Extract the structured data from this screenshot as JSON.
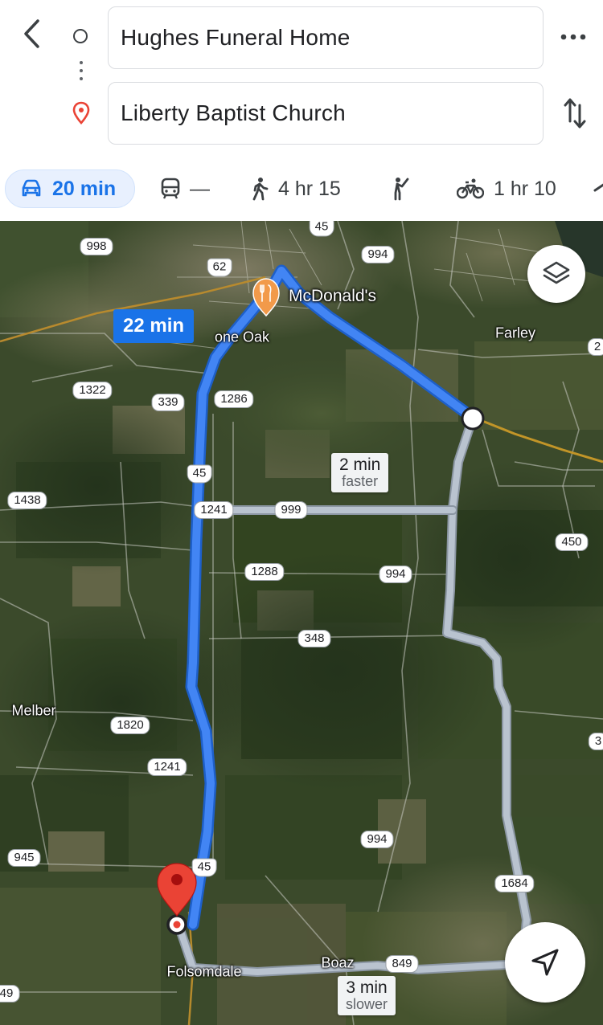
{
  "directions": {
    "origin": "Hughes Funeral Home",
    "destination": "Liberty Baptist Church"
  },
  "modes": [
    {
      "name": "car-icon",
      "label": "20 min",
      "selected": true
    },
    {
      "name": "transit-icon",
      "label": "—"
    },
    {
      "name": "walk-icon",
      "label": "4 hr 15"
    },
    {
      "name": "ride-hail-icon",
      "label": ""
    },
    {
      "name": "bike-icon",
      "label": "1 hr 10"
    }
  ],
  "map": {
    "route_main_time": "22 min",
    "alt_route_1": {
      "time": "2 min",
      "note": "faster"
    },
    "alt_route_2": {
      "time": "3 min",
      "note": "slower"
    },
    "poi": "McDonald's",
    "towns": {
      "lone_oak": "one Oak",
      "farley": "Farley",
      "melber": "Melber",
      "folsomdale": "Folsomdale",
      "boaz": "Boaz"
    },
    "shields": {
      "s45_top": "45",
      "s998": "998",
      "s994_top": "994",
      "s62": "62",
      "s2_right": "2",
      "s1322": "1322",
      "s339": "339",
      "s1286": "1286",
      "s45_mid": "45",
      "s1438": "1438",
      "s1241_a": "1241",
      "s999": "999",
      "s450": "450",
      "s1288": "1288",
      "s994_mid": "994",
      "s348": "348",
      "s1820": "1820",
      "s3_right": "3",
      "s1241_b": "1241",
      "s994_low": "994",
      "s945": "945",
      "s45_low": "45",
      "s1684": "1684",
      "s849": "849",
      "s49_left": "49"
    }
  },
  "colors": {
    "route_primary": "#4285f4",
    "route_alt": "#b9c3cf",
    "accent": "#1a73e8",
    "pin": "#ea4335",
    "poi": "#f29a4a"
  }
}
